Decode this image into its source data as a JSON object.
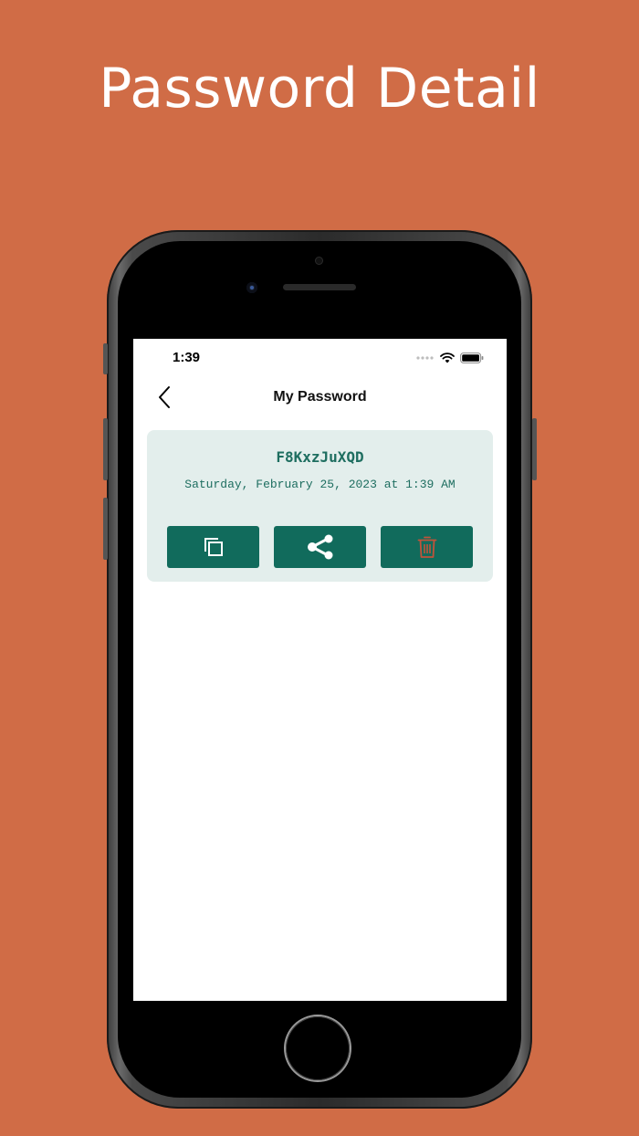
{
  "headline": "Password Detail",
  "status_bar": {
    "time": "1:39"
  },
  "nav": {
    "title": "My Password"
  },
  "password_card": {
    "password": "F8KxzJuXQD",
    "created": "Saturday, February 25, 2023 at 1:39 AM"
  },
  "icons": {
    "back": "chevron-left-icon",
    "copy": "copy-icon",
    "share": "share-icon",
    "delete": "trash-icon",
    "wifi": "wifi-icon",
    "battery": "battery-icon",
    "signal": "signal-dots-icon"
  },
  "colors": {
    "background": "#D06C46",
    "accent": "#116B5C",
    "card": "#E3EEEC",
    "text_accent": "#1E6E60",
    "delete_icon": "#C0533A"
  }
}
